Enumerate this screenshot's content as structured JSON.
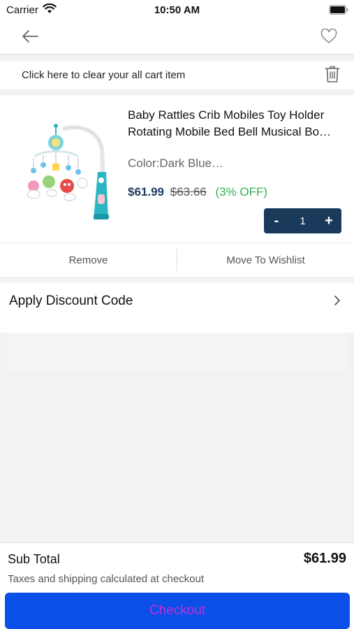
{
  "status_bar": {
    "carrier": "Carrier",
    "time": "10:50 AM"
  },
  "clear_cart": {
    "text": "Click here to clear your all cart item"
  },
  "cart_item": {
    "title": "Baby Rattles Crib Mobiles Toy Holder Rotating Mobile Bed Bell Musical Bo…",
    "color": "Color:Dark Blue…",
    "price_current": "$61.99",
    "price_original": "$63.66",
    "discount": "(3% OFF)",
    "quantity": "1",
    "minus_label": "-",
    "plus_label": "+",
    "remove_label": "Remove",
    "move_to_wishlist_label": "Move To Wishlist"
  },
  "discount_code": {
    "label": "Apply Discount Code"
  },
  "footer": {
    "subtotal_label": "Sub Total",
    "subtotal_value": "$61.99",
    "tax_note": "Taxes and shipping calculated at checkout",
    "checkout_label": "Checkout"
  },
  "colors": {
    "accent": "#0a4fe8",
    "stepper": "#1a3a5c",
    "discount_text": "#2fb24f",
    "checkout_text": "#c12fd6"
  },
  "icons": [
    "wifi-icon",
    "battery-icon",
    "back-arrow-icon",
    "heart-icon",
    "trash-icon",
    "chevron-right-icon"
  ]
}
